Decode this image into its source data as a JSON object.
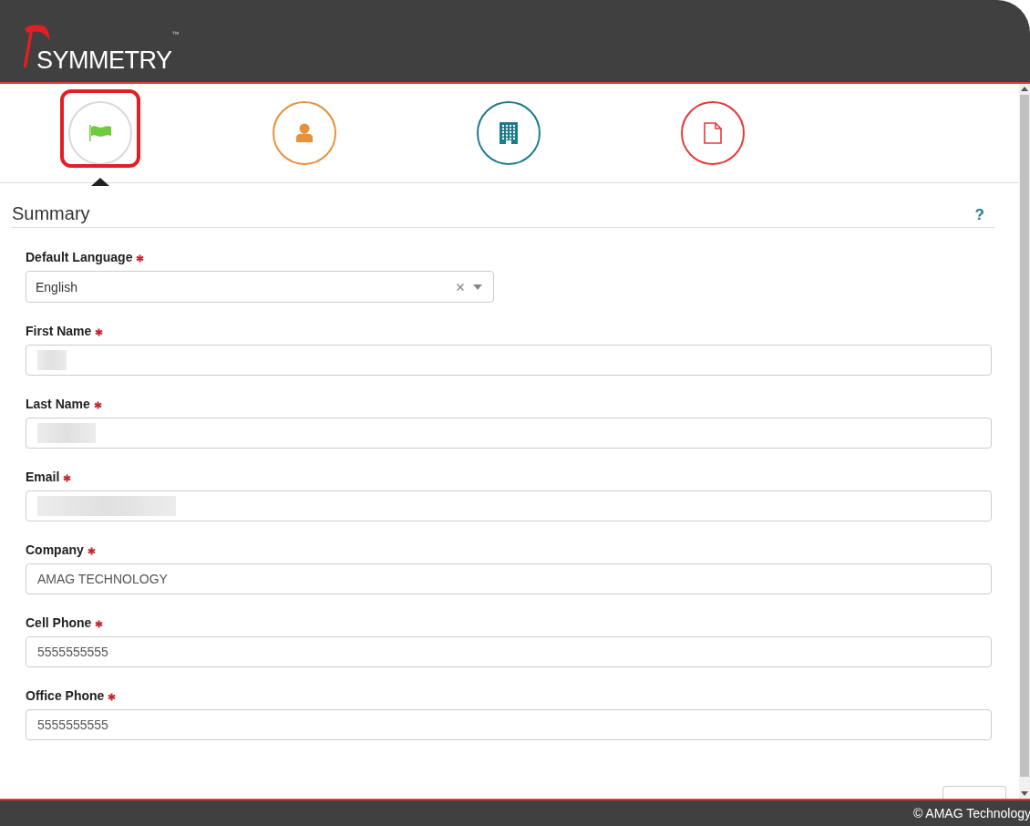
{
  "header": {
    "logo": "SYMMETRY",
    "trademark": "™"
  },
  "steps": [
    {
      "kind": "flag",
      "color": "#d9d9d9",
      "selected": true
    },
    {
      "kind": "person",
      "color": "#e8913a",
      "selected": false
    },
    {
      "kind": "building",
      "color": "#1e7b8c",
      "selected": false
    },
    {
      "kind": "document",
      "color": "#e53935",
      "selected": false
    }
  ],
  "section": {
    "title": "Summary",
    "help": "?"
  },
  "fields": [
    {
      "kind": "select",
      "label": "Default Language",
      "required": true,
      "value": "English",
      "redacted": false
    },
    {
      "kind": "text",
      "label": "First Name",
      "required": true,
      "redacted": true
    },
    {
      "kind": "text",
      "label": "Last Name",
      "required": true,
      "redacted": true
    },
    {
      "kind": "text",
      "label": "Email",
      "required": true,
      "redacted": true
    },
    {
      "kind": "text",
      "label": "Company",
      "required": true,
      "value": "AMAG TECHNOLOGY",
      "redacted": false
    },
    {
      "kind": "text",
      "label": "Cell Phone",
      "required": true,
      "value": "5555555555",
      "redacted": false
    },
    {
      "kind": "text",
      "label": "Office Phone",
      "required": true,
      "value": "5555555555",
      "redacted": false
    }
  ],
  "footer": {
    "copyright": "© AMAG Technology"
  }
}
